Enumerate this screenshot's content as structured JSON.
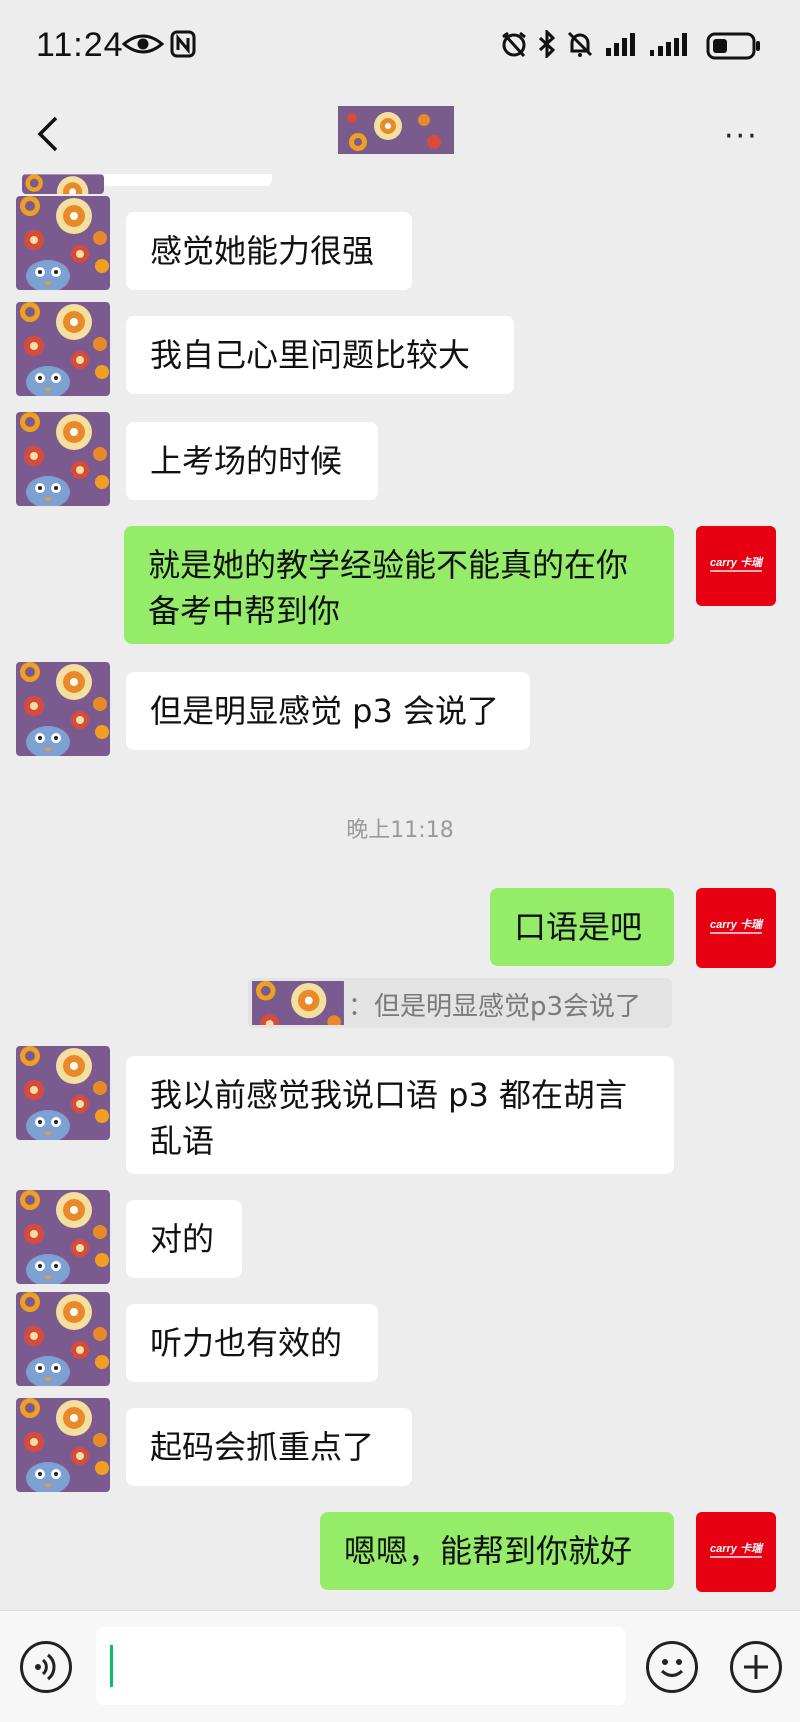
{
  "status_bar": {
    "time": "11:24"
  },
  "header": {
    "more_label": "···"
  },
  "messages": [
    {
      "side": "left",
      "text": "感觉她能力很强"
    },
    {
      "side": "left",
      "text": "我自己心里问题比较大"
    },
    {
      "side": "left",
      "text": "上考场的时候"
    },
    {
      "side": "right",
      "text": "就是她的教学经验能不能真的在你备考中帮到你"
    },
    {
      "side": "left",
      "text": "但是明显感觉 p3 会说了"
    },
    {
      "side": "right",
      "text": "口语是吧"
    },
    {
      "side": "left",
      "text": "我以前感觉我说口语 p3 都在胡言乱语"
    },
    {
      "side": "left",
      "text": "对的"
    },
    {
      "side": "left",
      "text": "听力也有效的"
    },
    {
      "side": "left",
      "text": "起码会抓重点了"
    },
    {
      "side": "right",
      "text": "嗯嗯，能帮到你就好"
    }
  ],
  "timestamp": "晚上11:18",
  "quote": {
    "text": "：但是明显感觉p3会说了"
  },
  "brand_logo_text": "carry 卡瑞",
  "colors": {
    "background": "#ededed",
    "bubble_self": "#95ec69",
    "bubble_other": "#ffffff",
    "avatar_brand": "#e60012",
    "caret": "#07c160"
  }
}
